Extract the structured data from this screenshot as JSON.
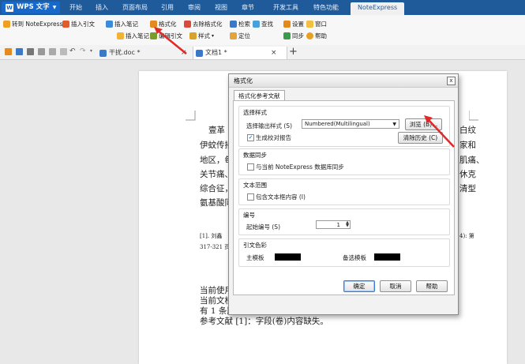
{
  "menubar": {
    "app_label": "WPS 文字",
    "tabs": [
      "开始",
      "插入",
      "页面布局",
      "引用",
      "审阅",
      "视图",
      "章节",
      "开发工具",
      "特色功能"
    ],
    "active_tab": "NoteExpress"
  },
  "ribbon": {
    "goto_ne": "转到 NoteExpress",
    "insert_cite": "插入引文",
    "insert_note": "插入笔记",
    "format": "格式化",
    "edit_cite": "编辑引文",
    "remove_format": "去除格式化",
    "style": "样式",
    "search": "检索",
    "find": "查找",
    "locate": "定位",
    "settings": "设置",
    "window": "窗口",
    "sync": "同步",
    "help": "帮助"
  },
  "tabs": {
    "doc1": "干扰.doc *",
    "doc2": "文档1 *",
    "new_tab": "+"
  },
  "document": {
    "line1_start": "壹革",
    "line1_end": "白纹",
    "line2_start": "伊蚊传播",
    "line2_end": "家和",
    "line3_start": "地区，每",
    "line3_end": "肌痛、",
    "line4_start": "关节痛、",
    "line4_end": "休克",
    "line5_start": "综合征，",
    "line5_end": "清型",
    "line6_start": "氨基酸同",
    "ref_start": "[1]. 刘鑫",
    "ref_end": "4): 第",
    "ref_pages": "317-321 页",
    "status1": "当前使用",
    "status2": "当前文档",
    "status3": "有 1 条题",
    "status4": "参考文献 [1]：字段(卷)内容缺失。"
  },
  "dialog": {
    "title": "格式化",
    "close": "x",
    "tab": "格式化参考文献",
    "style_group": "选择样式",
    "output_style_label": "选择输出样式 (S)",
    "output_style_value": "Numbered(Multilingual)",
    "browse_button": "浏览 (B)...",
    "gen_report": "生成校对报告",
    "clear_history": "清除历史 (C)",
    "sync_group": "数据同步",
    "sync_label": "与当前 NoteExpress 数据库同步",
    "text_range_group": "文本范围",
    "include_textbox": "包含文本框内容 (I)",
    "numbering_group": "编号",
    "start_number_label": "起始编号 (S)",
    "start_number_value": "1",
    "cite_color_group": "引文色彩",
    "main_template": "主模板",
    "alt_template": "备选模板",
    "ok": "确定",
    "cancel": "取消",
    "help": "帮助"
  },
  "colors": {
    "menubar": "#1f5a9a",
    "arrow": "#e02a2a",
    "swatch": "#000000"
  }
}
